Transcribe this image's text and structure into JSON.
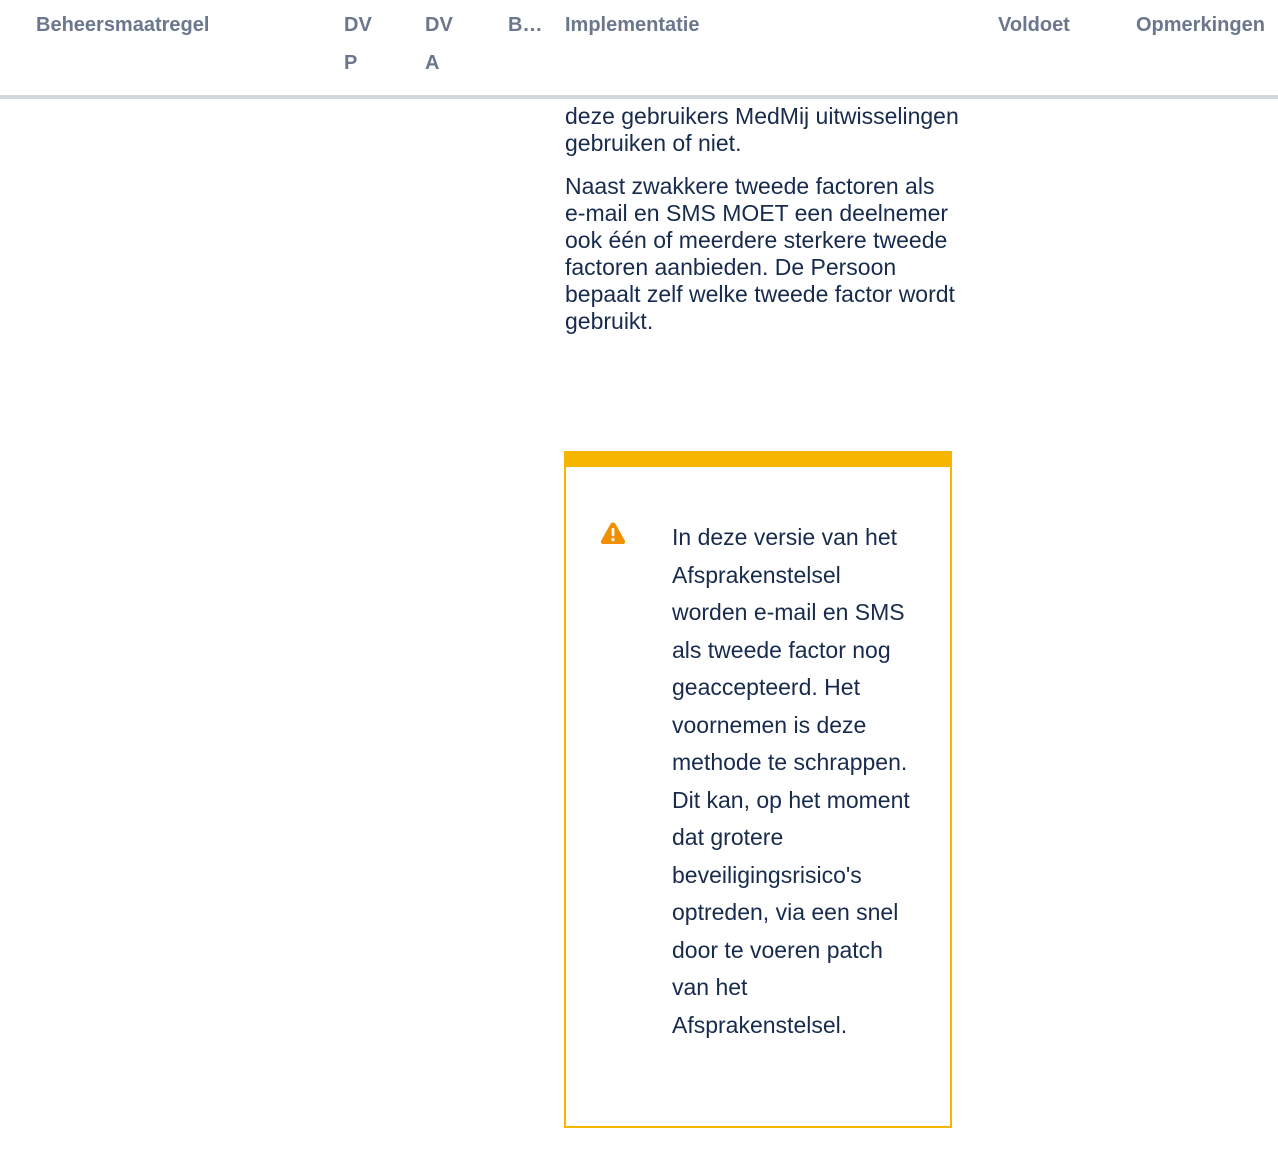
{
  "table": {
    "headers": {
      "beheersmaatregel": "Beheersmaatregel",
      "dvp": "DVP",
      "dva": "DVA",
      "b": "B…",
      "implementatie": "Implementatie",
      "voldoet": "Voldoet",
      "opmerkingen": "Opmerkingen"
    },
    "implementatie": {
      "paragraph_1": "deze gebruikers MedMij uitwisselingen gebruiken of niet.",
      "paragraph_2": "Naast zwakkere tweede factoren als e-mail en SMS MOET een deelnemer ook één of meerdere sterkere tweede factoren aanbieden. De Persoon bepaalt zelf welke tweede factor wordt gebruikt."
    },
    "warning": {
      "icon": "warning-triangle-icon",
      "accent_color": "#f7b500",
      "text": "In deze versie van het Afsprakenstelsel worden e-mail en SMS als tweede factor nog geaccepteerd. Het voornemen is deze methode te schrappen. Dit kan, op het moment dat grotere beveiligingsrisico's optreden, via een snel door te voeren patch van het Afsprakenstelsel."
    }
  }
}
